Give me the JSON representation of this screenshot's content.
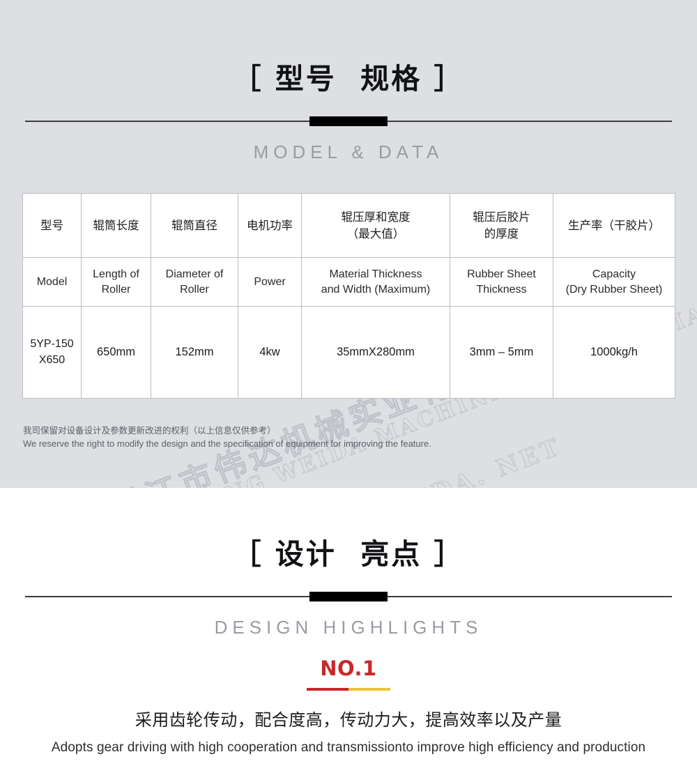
{
  "section_model": {
    "heading_cn": "［ 型号  规格 ］",
    "heading_en": "MODEL & DATA",
    "table": {
      "header_cn": [
        "型号",
        "辊筒长度",
        "辊筒直径",
        "电机功率",
        "辊压厚和宽度\n（最大值）",
        "辊压后胶片\n的厚度",
        "生产率（干胶片）"
      ],
      "header_en": [
        "Model",
        "Length of\nRoller",
        "Diameter of\nRoller",
        "Power",
        "Material Thickness\nand Width (Maximum)",
        "Rubber Sheet\nThickness",
        "Capacity\n(Dry Rubber Sheet)"
      ],
      "rows": [
        [
          "5YP-150\nX650",
          "650mm",
          "152mm",
          "4kw",
          "35mmX280mm",
          "3mm – 5mm",
          "1000kg/h"
        ]
      ]
    },
    "disclaimer_cn": "我司保留对设备设计及参数更新改进的权利（以上信息仅供参考）",
    "disclaimer_en": "We reserve the right to modify the design and the specification of equipment for improving the feature."
  },
  "watermark": {
    "line_cn": "湛江市伟达机械实业有限公司",
    "line_en": "ZHANJIANG  WEIDA MACHINERY  INDUSTRIAL  CO.,  LTD",
    "line_url": "WWW. ZJWEIDA. NET"
  },
  "section_highlights": {
    "heading_cn": "［ 设计  亮点 ］",
    "heading_en": "DESIGN HIGHLIGHTS",
    "items": [
      {
        "number": "NO.1",
        "text_cn": "采用齿轮传动，配合度高，传动力大，提高效率以及产量",
        "text_en": "Adopts gear driving with high cooperation and transmissionto improve high efficiency and production"
      }
    ]
  },
  "colors": {
    "page_bg_grey": "#dedfe3",
    "page_bg_white": "#ffffff",
    "heading_black": "#111215",
    "subtitle_grey": "#9a9ca3",
    "rule_grey": "#3b3b3e",
    "accent_red": "#c8282a",
    "accent_yellow": "#e8c53c",
    "table_border": "#b9bbc0",
    "body_text": "#1b1c1e",
    "disclaimer_text": "#5d5f66"
  }
}
